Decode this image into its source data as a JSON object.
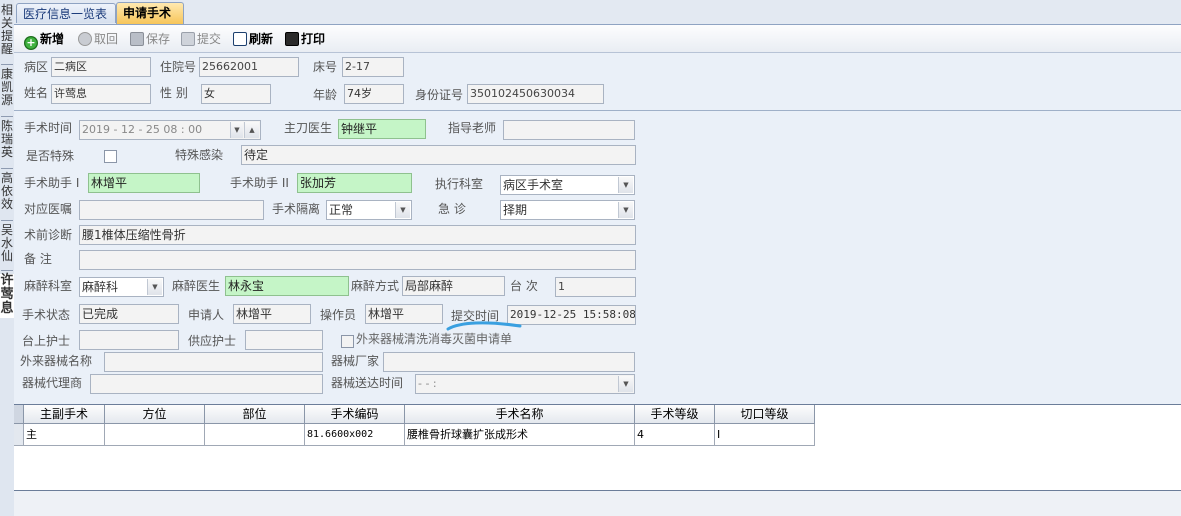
{
  "left_strip": {
    "names": [
      "相关提醒",
      "康凯源",
      "陈瑞英",
      "高依效",
      "吴水仙",
      "许莺息"
    ]
  },
  "tabs": [
    {
      "label": "医疗信息一览表",
      "active": false
    },
    {
      "label": "申请手术",
      "active": true
    }
  ],
  "toolbar": {
    "new": "新增",
    "revoke": "取回",
    "save": "保存",
    "submit": "提交",
    "refresh": "刷新",
    "print": "打印"
  },
  "patient": {
    "ward_label": "病区",
    "ward": "二病区",
    "inpatient_no_label": "住院号",
    "inpatient_no": "25662001",
    "bed_label": "床号",
    "bed": "2-17",
    "name_label": "姓名",
    "name": "许莺息",
    "gender_label": "性  别",
    "gender": "女",
    "age_label": "年龄",
    "age": "74岁",
    "id_label": "身份证号",
    "id_no": "350102450630034"
  },
  "surgery": {
    "time_label": "手术时间",
    "time": "2019 - 12 - 25   08 : 00",
    "surgeon_label": "主刀医生",
    "surgeon": "钟继平",
    "mentor_label": "指导老师",
    "mentor": "",
    "special_label": "是否特殊",
    "special_infection_label": "特殊感染",
    "special_infection": "待定",
    "assistant1_label": "手术助手 I",
    "assistant1": "林增平",
    "assistant2_label": "手术助手 II",
    "assistant2": "张加芳",
    "exec_dept_label": "执行科室",
    "exec_dept": "病区手术室",
    "order_label": "对应医嘱",
    "order": "",
    "isolation_label": "手术隔离",
    "isolation": "正常",
    "emergency_label": "急    诊",
    "emergency": "择期",
    "diagnosis_label": "术前诊断",
    "diagnosis": "腰1椎体压缩性骨折",
    "remark_label": "备    注",
    "remark": "",
    "anesth_dept_label": "麻醉科室",
    "anesth_dept": "麻醉科",
    "anesth_doctor_label": "麻醉医生",
    "anesth_doctor": "林永宝",
    "anesth_method_label": "麻醉方式",
    "anesth_method": "局部麻醉",
    "table_no_label": "台  次",
    "table_no": "1",
    "status_label": "手术状态",
    "status": "已完成",
    "applicant_label": "申请人",
    "applicant": "林增平",
    "operator_label": "操作员",
    "operator": "林增平",
    "submit_time_label": "提交时间",
    "submit_time": "2019-12-25 15:58:08",
    "scrub_nurse_label": "台上护士",
    "scrub_nurse": "",
    "supply_nurse_label": "供应护士",
    "supply_nurse": "",
    "external_clean_label": "外来器械清洗消毒灭菌申请单",
    "ext_device_name_label": "外来器械名称",
    "ext_device_name": "",
    "device_maker_label": "器械厂家",
    "device_maker": "",
    "device_agent_label": "器械代理商",
    "device_agent": "",
    "device_delivery_label": "器械送达时间",
    "device_delivery": "  -   -          :"
  },
  "grid": {
    "headers": [
      "主副手术",
      "方位",
      "部位",
      "手术编码",
      "手术名称",
      "手术等级",
      "切口等级"
    ],
    "rows": [
      [
        "主",
        "",
        "",
        "81.6600x002",
        "腰椎骨折球囊扩张成形术",
        "4",
        "I"
      ]
    ]
  },
  "colors": {
    "required_field": "#c5f5c7",
    "active_tab": "#f7c55a",
    "annotation": "#3aa0e0"
  }
}
